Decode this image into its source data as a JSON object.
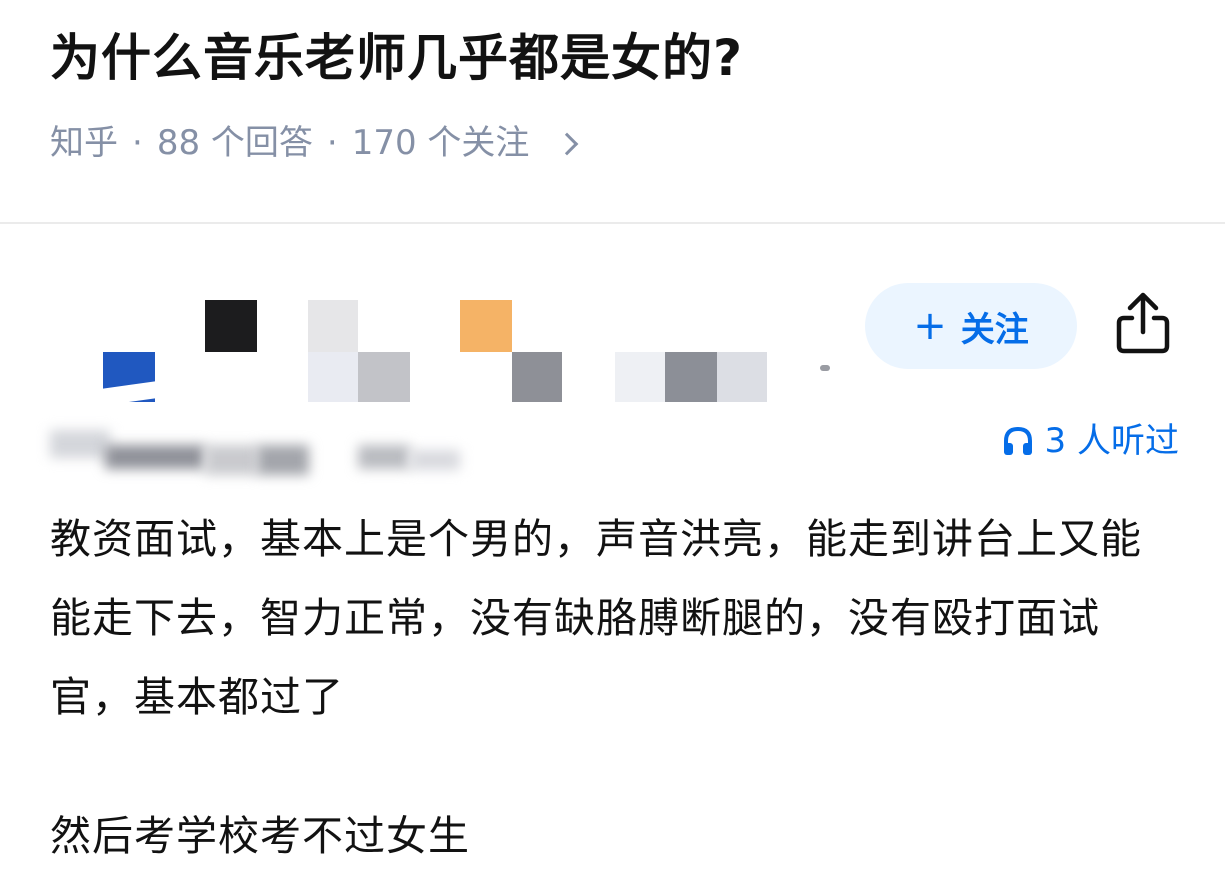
{
  "question": {
    "title": "为什么音乐老师几乎都是女的?",
    "meta": {
      "source": "知乎",
      "separator": "·",
      "answers": "88 个回答",
      "followers": "170 个关注"
    }
  },
  "author": {
    "follow_label": "关注",
    "follow_plus": "+",
    "listened": "3 人听过",
    "colors": {
      "accent": "#056de8",
      "follow_bg": "#ebf5ff"
    }
  },
  "answer": {
    "paragraphs": [
      "教资面试，基本上是个男的，声音洪亮，能走到讲台上又能能走下去，智力正常，没有缺胳膊断腿的，没有殴打面试官，基本都过了",
      "然后考学校考不过女生"
    ]
  },
  "icons": {
    "chevron": "chevron-right-icon",
    "share": "share-icon",
    "headphones": "headphones-icon"
  }
}
